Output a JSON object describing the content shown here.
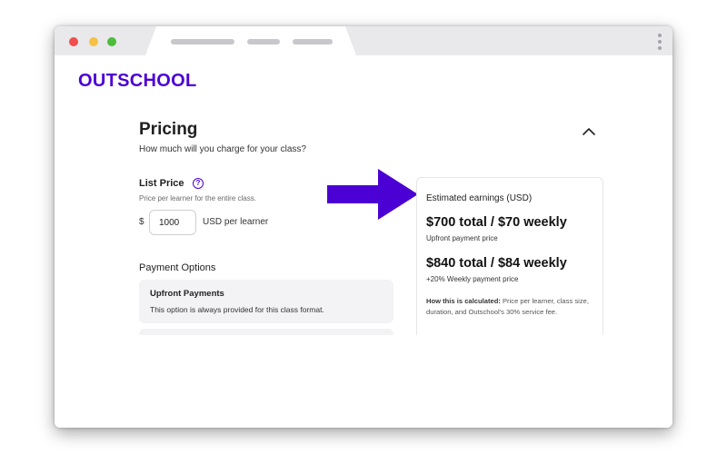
{
  "brand": {
    "logo_text": "OUTSCHOOL",
    "accent": "#4b01d4"
  },
  "section": {
    "title": "Pricing",
    "subtitle": "How much will you charge for your class?",
    "collapse_icon": "chevron-up-icon"
  },
  "list_price": {
    "label": "List Price",
    "help_icon": "question-circle-icon",
    "help_glyph": "?",
    "description": "Price per learner for the entire class.",
    "currency_symbol": "$",
    "value": "1000",
    "unit": "USD per learner"
  },
  "payment_options": {
    "label": "Payment Options",
    "upfront": {
      "title": "Upfront Payments",
      "description": "This option is always provided for this class format."
    }
  },
  "earnings": {
    "heading": "Estimated earnings (USD)",
    "upfront_line": "$700 total / $70 weekly",
    "upfront_caption": "Upfront payment price",
    "weekly_line": "$840 total / $84 weekly",
    "weekly_caption": "+20% Weekly payment price",
    "note_bold": "How this is calculated:",
    "note_text": " Price per learner, class size, duration, and Outschool's 30% service fee."
  },
  "callout": {
    "icon": "arrow-right-icon",
    "color": "#4b01d4"
  }
}
